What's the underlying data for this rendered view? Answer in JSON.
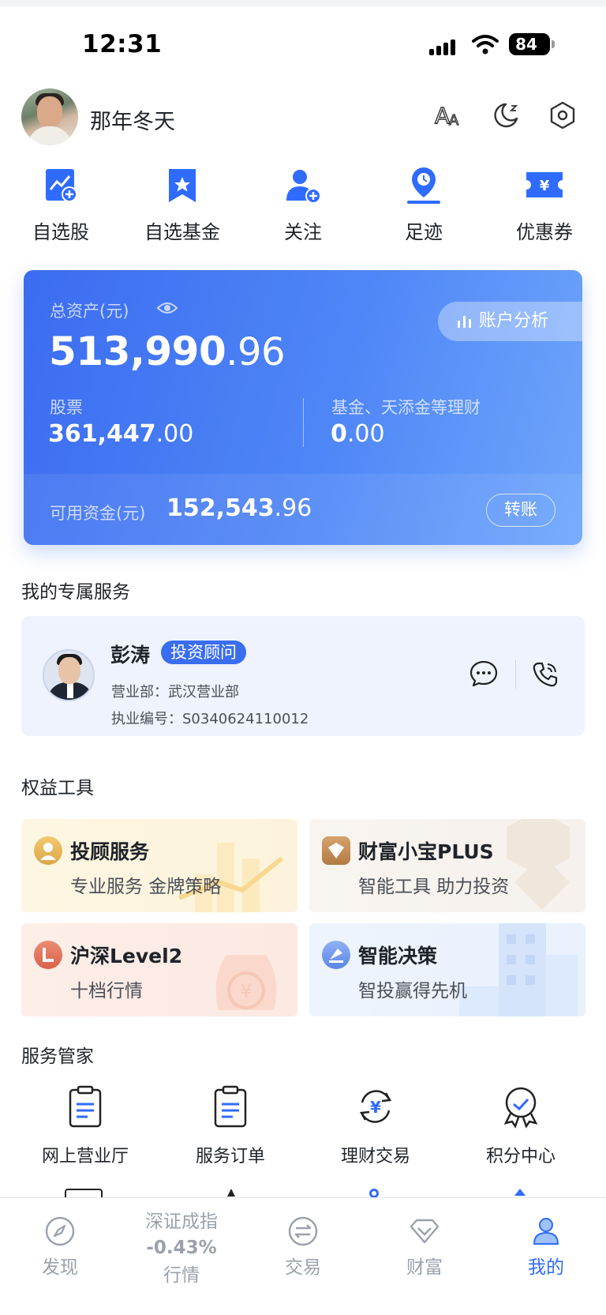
{
  "status_bar": {
    "time": "12:31",
    "battery": "84"
  },
  "profile": {
    "username": "那年冬天"
  },
  "quick_actions": [
    {
      "label": "自选股",
      "icon": "stock-trend-icon"
    },
    {
      "label": "自选基金",
      "icon": "bookmark-star-icon"
    },
    {
      "label": "关注",
      "icon": "user-add-icon"
    },
    {
      "label": "足迹",
      "icon": "location-clock-icon"
    },
    {
      "label": "优惠券",
      "icon": "coupon-yuan-icon"
    }
  ],
  "asset_card": {
    "total_label": "总资产(元)",
    "total_int": "513,990",
    "total_dec": ".96",
    "analysis_label": "账户分析",
    "stock_label": "股票",
    "stock_int": "361,447",
    "stock_dec": ".00",
    "fund_label": "基金、天添金等理财",
    "fund_int": "0",
    "fund_dec": ".00",
    "available_label": "可用资金(元)",
    "available_int": "152,543",
    "available_dec": ".96",
    "transfer_label": "转账"
  },
  "exclusive_service": {
    "title": "我的专属服务",
    "advisor_name": "彭涛",
    "advisor_tag": "投资顾问",
    "department": "营业部：武汉营业部",
    "license": "执业编号：S0340624110012"
  },
  "benefit_tools": {
    "title": "权益工具",
    "cards": [
      {
        "title": "投顾服务",
        "subtitle": "专业服务 金牌策略"
      },
      {
        "title": "财富小宝PLUS",
        "subtitle": "智能工具 助力投资"
      },
      {
        "title": "沪深Level2",
        "subtitle": "十档行情"
      },
      {
        "title": "智能决策",
        "subtitle": "智投赢得先机"
      }
    ]
  },
  "service_manager": {
    "title": "服务管家",
    "items": [
      {
        "label": "网上营业厅"
      },
      {
        "label": "服务订单"
      },
      {
        "label": "理财交易"
      },
      {
        "label": "积分中心"
      }
    ]
  },
  "tab_bar": {
    "tabs": [
      {
        "label": "发现"
      },
      {
        "label": "行情",
        "index_name": "深证成指",
        "index_change": "-0.43%"
      },
      {
        "label": "交易"
      },
      {
        "label": "财富"
      },
      {
        "label": "我的"
      }
    ],
    "active": "我的"
  },
  "colors": {
    "brand_blue": "#3a6df0",
    "tab_active": "#2f6bff",
    "index_green": "#17a34a"
  }
}
